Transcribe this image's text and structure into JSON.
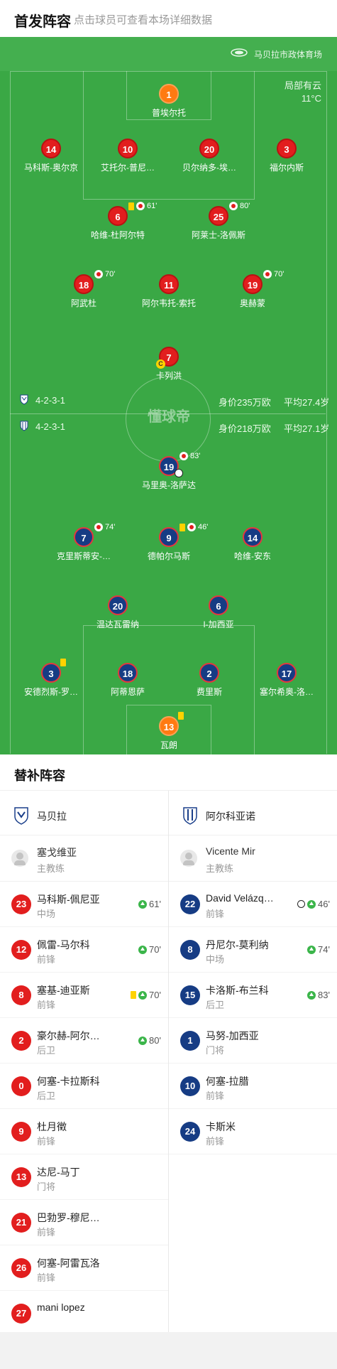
{
  "header": {
    "title": "首发阵容",
    "subtitle": "点击球员可查看本场详细数据"
  },
  "pitch": {
    "venue": "马贝拉市政体育场",
    "weather": "局部有云",
    "temperature": "11°C",
    "center_logo": "懂球帝",
    "home_row": {
      "formation": "4-2-3-1",
      "value": "身价235万欧",
      "age": "平均27.4岁"
    },
    "away_row": {
      "formation": "4-2-3-1",
      "value": "身价218万欧",
      "age": "平均27.1岁"
    },
    "home_players": [
      {
        "number": "1",
        "name": "普埃尔托",
        "kit": "gk"
      },
      {
        "number": "14",
        "name": "马科斯-奥尔京",
        "kit": "red"
      },
      {
        "number": "10",
        "name": "艾托尔-普尼…",
        "kit": "red"
      },
      {
        "number": "20",
        "name": "贝尔纳多-埃…",
        "kit": "red"
      },
      {
        "number": "3",
        "name": "福尔内斯",
        "kit": "red"
      },
      {
        "number": "6",
        "name": "哈维-杜阿尔特",
        "kit": "red",
        "event": "61'",
        "yellow": true,
        "sub": true
      },
      {
        "number": "25",
        "name": "阿莱士-洛佩斯",
        "kit": "red",
        "event": "80'",
        "sub": true
      },
      {
        "number": "18",
        "name": "阿武杜",
        "kit": "red",
        "event": "70'",
        "sub": true
      },
      {
        "number": "11",
        "name": "阿尔韦托-索托",
        "kit": "red"
      },
      {
        "number": "19",
        "name": "奥赫蒙",
        "kit": "red",
        "event": "70'",
        "sub": true
      },
      {
        "number": "7",
        "name": "卡列洪",
        "kit": "red",
        "captain": "C"
      }
    ],
    "away_players": [
      {
        "number": "19",
        "name": "马里奥-洛萨达",
        "kit": "blue",
        "event": "83'",
        "sub": true,
        "goal": true
      },
      {
        "number": "7",
        "name": "克里斯蒂安-…",
        "kit": "blue",
        "event": "74'",
        "sub": true
      },
      {
        "number": "9",
        "name": "德帕尔马斯",
        "kit": "blue",
        "event": "46'",
        "yellow": true,
        "sub": true
      },
      {
        "number": "14",
        "name": "哈维-安东",
        "kit": "blue"
      },
      {
        "number": "20",
        "name": "温达瓦雷纳",
        "kit": "blue"
      },
      {
        "number": "6",
        "name": "I-加西亚",
        "kit": "blue"
      },
      {
        "number": "3",
        "name": "安德烈斯-罗…",
        "kit": "blue",
        "yellow": true
      },
      {
        "number": "18",
        "name": "阿蒂恩萨",
        "kit": "blue"
      },
      {
        "number": "2",
        "name": "费里斯",
        "kit": "blue"
      },
      {
        "number": "17",
        "name": "塞尔希奥-洛…",
        "kit": "blue"
      },
      {
        "number": "13",
        "name": "瓦朗",
        "kit": "gk",
        "yellow": true
      }
    ]
  },
  "subs": {
    "title": "替补阵容",
    "home": {
      "team": "马贝拉",
      "coach": {
        "name": "塞戈维亚",
        "role": "主教练"
      },
      "players": [
        {
          "number": "23",
          "name": "马科斯-佩尼亚",
          "pos": "中场",
          "event": "61'",
          "up": true
        },
        {
          "number": "12",
          "name": "佩雷-马尔科",
          "pos": "前锋",
          "event": "70'",
          "up": true
        },
        {
          "number": "8",
          "name": "塞基-迪亚斯",
          "pos": "前锋",
          "event": "70'",
          "up": true,
          "yellow": true
        },
        {
          "number": "2",
          "name": "豪尔赫-阿尔…",
          "pos": "后卫",
          "event": "80'",
          "up": true
        },
        {
          "number": "0",
          "name": "何塞-卡拉斯科",
          "pos": "后卫"
        },
        {
          "number": "9",
          "name": "杜月徵",
          "pos": "前锋"
        },
        {
          "number": "13",
          "name": "达尼-马丁",
          "pos": "门将"
        },
        {
          "number": "21",
          "name": "巴勃罗-穆尼…",
          "pos": "前锋"
        },
        {
          "number": "26",
          "name": "何塞-阿雷瓦洛",
          "pos": "前锋"
        },
        {
          "number": "27",
          "name": "mani lopez",
          "pos": ""
        }
      ]
    },
    "away": {
      "team": "阿尔科亚诺",
      "coach": {
        "name": "Vicente Mir",
        "role": "主教练"
      },
      "players": [
        {
          "number": "22",
          "name": "David Velázq…",
          "pos": "前锋",
          "event": "46'",
          "up": true,
          "goal": true
        },
        {
          "number": "8",
          "name": "丹尼尔-莫利纳",
          "pos": "中场",
          "event": "74'",
          "up": true
        },
        {
          "number": "15",
          "name": "卡洛斯-布兰科",
          "pos": "后卫",
          "event": "83'",
          "up": true
        },
        {
          "number": "1",
          "name": "马努-加西亚",
          "pos": "门将"
        },
        {
          "number": "10",
          "name": "何塞-拉腊",
          "pos": "前锋"
        },
        {
          "number": "24",
          "name": "卡斯米",
          "pos": "前锋"
        }
      ]
    }
  }
}
